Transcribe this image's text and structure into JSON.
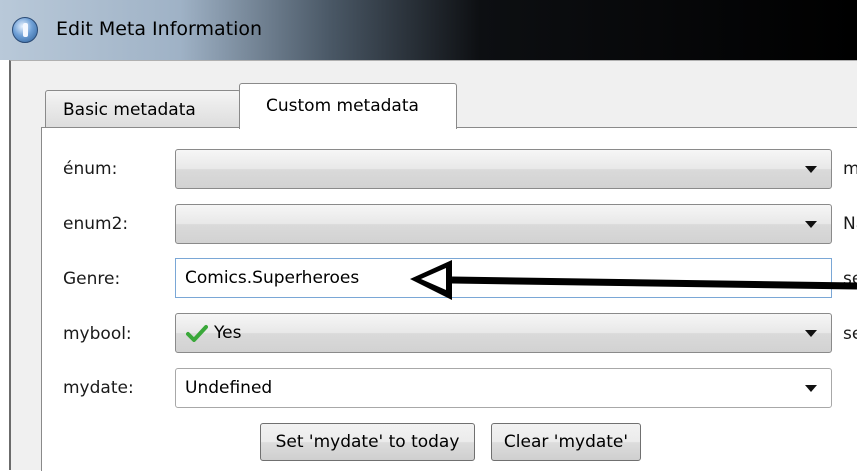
{
  "window": {
    "title": "Edit Meta Information",
    "icon": "info-icon"
  },
  "tabs": [
    {
      "label": "Basic metadata",
      "active": false
    },
    {
      "label": "Custom metadata",
      "active": true
    }
  ],
  "fields": {
    "enum": {
      "label": "énum:",
      "value": "",
      "side_text": "my"
    },
    "enum2": {
      "label": "enum2:",
      "value": "",
      "side_text": "Na"
    },
    "genre": {
      "label": "Genre:",
      "value": "Comics.Superheroes",
      "side_text": "ser"
    },
    "mybool": {
      "label": "mybool:",
      "value": "Yes",
      "value_icon": "checkmark-icon",
      "side_text": "ser"
    },
    "mydate": {
      "label": "mydate:",
      "value": "Undefined"
    }
  },
  "buttons": {
    "set_today": "Set 'mydate' to today",
    "clear": "Clear 'mydate'"
  },
  "annotation": {
    "type": "arrow",
    "points_to": "genre-input",
    "color": "#000000"
  }
}
